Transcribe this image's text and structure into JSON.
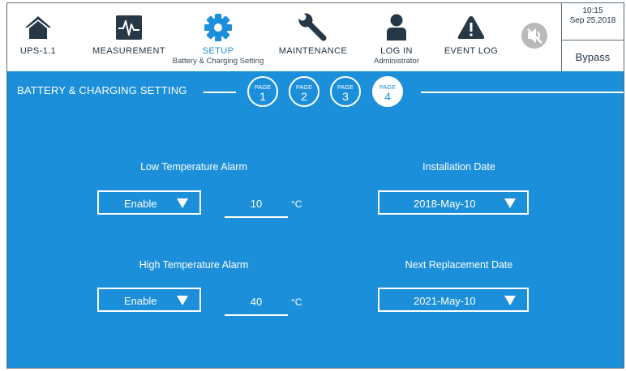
{
  "nav": {
    "items": [
      {
        "label": "UPS-1.1",
        "sub": "",
        "icon": "house-icon"
      },
      {
        "label": "MEASUREMENT",
        "sub": "",
        "icon": "waveform-icon"
      },
      {
        "label": "SETUP",
        "sub": "Battery & Charging Setting",
        "icon": "gear-icon"
      },
      {
        "label": "MAINTENANCE",
        "sub": "",
        "icon": "wrench-icon"
      },
      {
        "label": "LOG IN",
        "sub": "Administrator",
        "icon": "user-icon"
      },
      {
        "label": "EVENT LOG",
        "sub": "",
        "icon": "warning-icon"
      }
    ],
    "active_item": "SETUP",
    "mute_icon": "speaker-muted-icon"
  },
  "status": {
    "time": "10:15",
    "date": "Sep 25,2018",
    "mode": "Bypass"
  },
  "panel": {
    "title": "BATTERY & CHARGING SETTING",
    "pages": [
      {
        "label": "PAGE",
        "number": "1"
      },
      {
        "label": "PAGE",
        "number": "2"
      },
      {
        "label": "PAGE",
        "number": "3"
      },
      {
        "label": "PAGE",
        "number": "4"
      }
    ],
    "active_page": "4"
  },
  "settings": {
    "low_temp": {
      "title": "Low Temperature Alarm",
      "state": "Enable",
      "value": "10",
      "unit": "°C"
    },
    "high_temp": {
      "title": "High Temperature Alarm",
      "state": "Enable",
      "value": "40",
      "unit": "°C"
    },
    "install_date": {
      "title": "Installation Date",
      "value": "2018-May-10"
    },
    "replace_date": {
      "title": "Next Replacement Date",
      "value": "2021-May-10"
    }
  },
  "colors": {
    "accent": "#1c8fdb",
    "icon_dark": "#263746",
    "border": "#5b6d7c"
  }
}
